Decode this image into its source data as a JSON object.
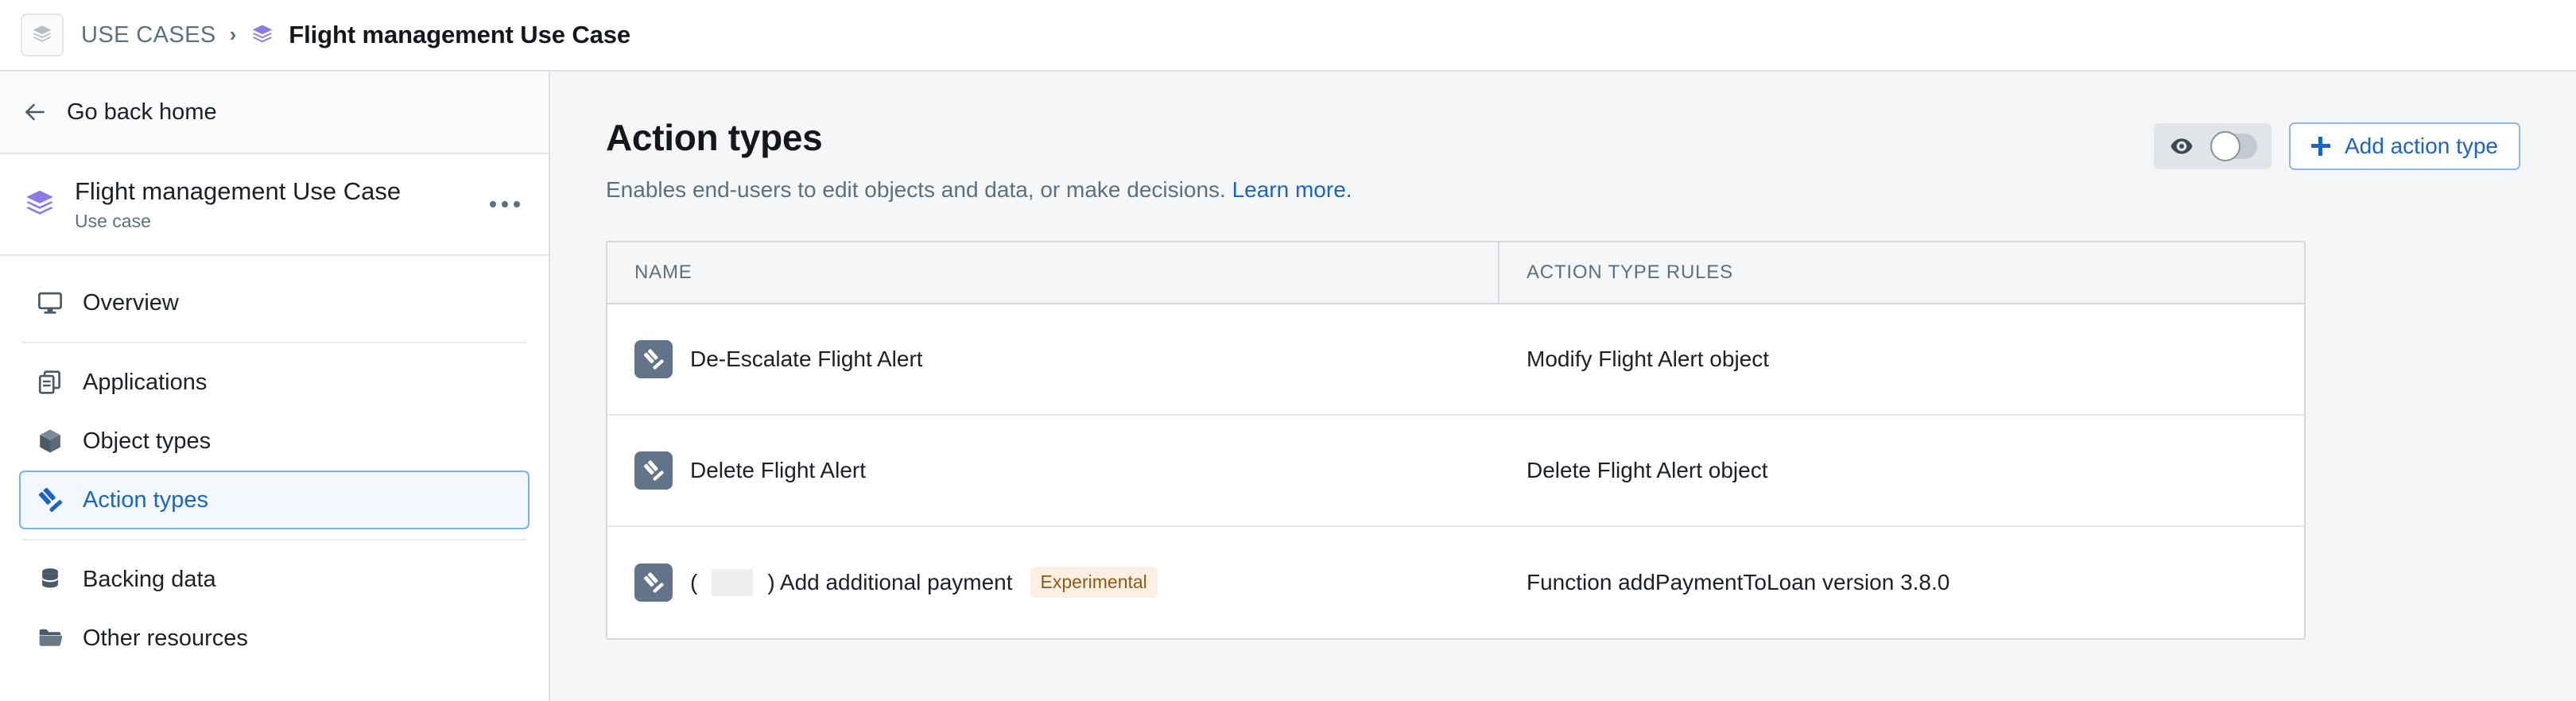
{
  "breadcrumb": {
    "app_icon": "layers-icon",
    "root": "USE CASES",
    "separator": "›",
    "leaf_icon": "layers-icon",
    "leaf": "Flight management Use Case"
  },
  "sidebar": {
    "go_back": {
      "label": "Go back home",
      "icon": "arrow-left-icon"
    },
    "use_case": {
      "icon": "layers-icon",
      "title": "Flight management Use Case",
      "subtitle": "Use case",
      "more_icon": "more-horizontal-icon"
    },
    "items": [
      {
        "label": "Overview",
        "icon": "monitor-icon",
        "selected": false
      },
      {
        "label": "Applications",
        "icon": "applications-icon",
        "selected": false
      },
      {
        "label": "Object types",
        "icon": "cube-icon",
        "selected": false
      },
      {
        "label": "Action types",
        "icon": "gavel-icon",
        "selected": true
      },
      {
        "label": "Backing data",
        "icon": "database-icon",
        "selected": false
      },
      {
        "label": "Other resources",
        "icon": "folder-icon",
        "selected": false
      }
    ]
  },
  "main": {
    "title": "Action types",
    "description": "Enables end-users to edit objects and data, or make decisions.",
    "learn_more": "Learn more.",
    "visibility_toggle": {
      "icon": "eye-icon",
      "state": "off"
    },
    "add_button": {
      "label": "Add action type",
      "icon": "plus-icon"
    },
    "table": {
      "columns": [
        "NAME",
        "ACTION TYPE RULES"
      ],
      "rows": [
        {
          "icon": "gavel-icon",
          "name": "De-Escalate Flight Alert",
          "redacted": false,
          "badge": "",
          "rules": "Modify Flight Alert object"
        },
        {
          "icon": "gavel-icon",
          "name": "Delete Flight Alert",
          "redacted": false,
          "badge": "",
          "rules": "Delete Flight Alert object"
        },
        {
          "icon": "gavel-icon",
          "name_prefix": "(",
          "name_suffix": ") Add additional payment",
          "name": "( ) Add additional payment",
          "redacted": true,
          "badge": "Experimental",
          "rules": "Function addPaymentToLoan version 3.8.0"
        }
      ]
    }
  },
  "colors": {
    "accent_blue": "#1c64c4",
    "purple": "#8c7ae6",
    "badge_text": "#8a5a17",
    "badge_bg": "#fdf0e3",
    "icon_slate": "#62748a",
    "main_bg": "#f5f6f8"
  }
}
